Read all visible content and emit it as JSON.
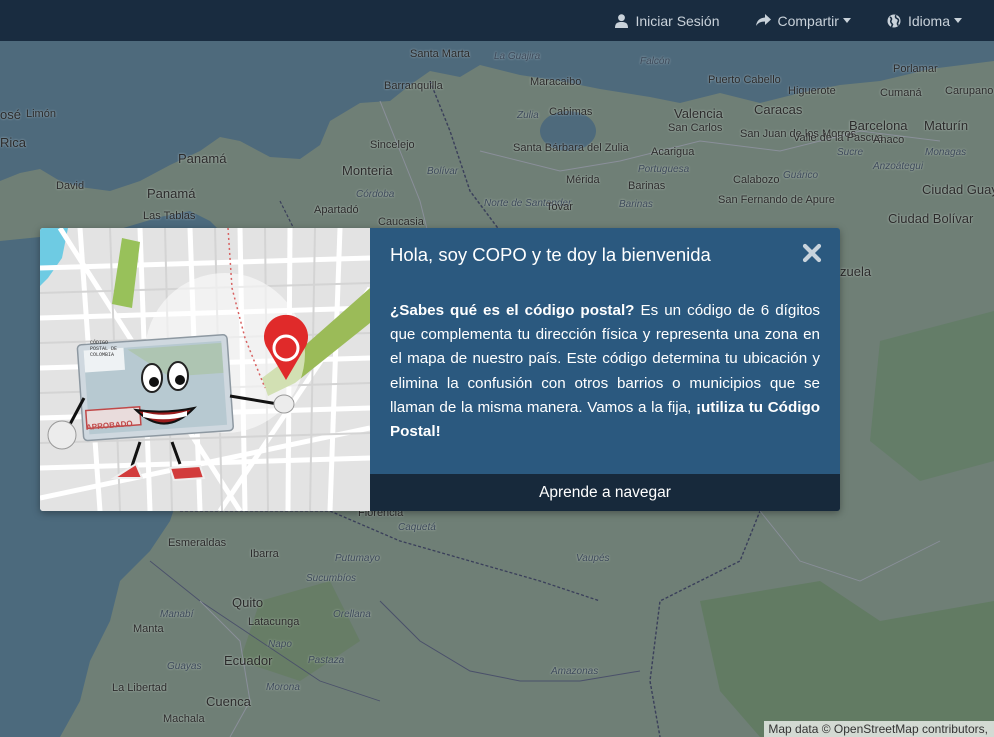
{
  "nav": {
    "login_label": "Iniciar Sesión",
    "share_label": "Compartir",
    "language_label": "Idioma"
  },
  "icons": {
    "login": "user-icon",
    "share": "share-icon",
    "language": "globe-icon",
    "close": "close-icon"
  },
  "colors": {
    "navbar": "#192c40",
    "modal": "#2b597f",
    "modal_footer": "#17293b",
    "map_land": "#6f7f76",
    "map_sea": "#4d6a7c"
  },
  "modal": {
    "title": "Hola, soy COPO y te doy la bienvenida",
    "body_bold_intro": "¿Sabes qué es el código postal?",
    "body_text": " Es un código de 6 dígitos que complementa tu dirección física y representa una zona en el mapa de nuestro país. Este código determina tu ubicación y elimina la confusión con otros barrios o municipios que se llaman de la misma manera. Vamos a la fija, ",
    "body_bold_outro": "¡utiliza tu Código Postal!",
    "footer_button": "Aprende a navegar",
    "illustration": {
      "card_header": "CÓDIGO POSTAL DE COLOMBIA",
      "stamp": "APROBADO"
    }
  },
  "map": {
    "places": [
      "Santa Marta",
      "La Guajira",
      "Falcón",
      "Porlamar",
      "Barranquilla",
      "Maracaibo",
      "Puerto Cabello",
      "Higuerote",
      "Cumaná",
      "Carupano",
      "osé",
      "Limón",
      "Rica",
      "Valencia",
      "Caracas",
      "Cabimas",
      "San Carlos",
      "Zulia",
      "Barcelona",
      "Maturín",
      "Panamá",
      "Sincelejo",
      "San Juan de los Morros",
      "Valle de la Pascua",
      "Acarigua",
      "Anaco",
      "Santa Bárbara del Zulia",
      "Sucre",
      "Monagas",
      "Portuguesa",
      "Monteria",
      "David",
      "Bolívar",
      "Mérida",
      "Barinas",
      "Calabozo",
      "Guárico",
      "Anzoátegui",
      "Córdoba",
      "Ciudad Guay",
      "Panamá",
      "Norte de Santander",
      "Tovar",
      "Barinas",
      "San Fernando de Apure",
      "Las Tablas",
      "Apartadó",
      "Ciudad Bolívar",
      "Caucasia",
      "zuela",
      "Florencia",
      "Caquetá",
      "Esmeraldas",
      "Ibarra",
      "Putumayo",
      "Vaupés",
      "Sucumbíos",
      "Quito",
      "Manabí",
      "Manta",
      "Latacunga",
      "Orellana",
      "Napo",
      "Guayas",
      "Ecuador",
      "Pastaza",
      "Amazonas",
      "La Libertad",
      "Cuenca",
      "Morona",
      "Machala"
    ],
    "attribution": "Map data © OpenStreetMap contributors,"
  }
}
